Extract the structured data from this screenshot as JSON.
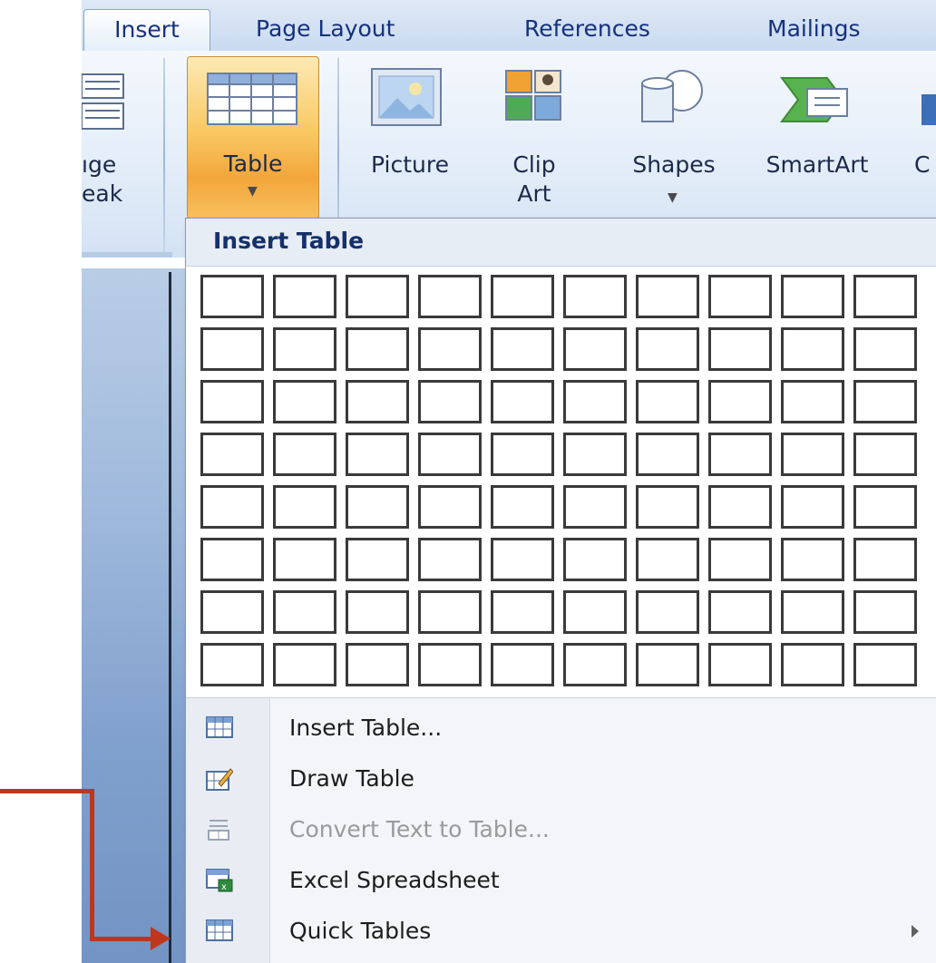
{
  "tabs": [
    {
      "label": "Insert",
      "active": true
    },
    {
      "label": "Page Layout",
      "active": false
    },
    {
      "label": "References",
      "active": false
    },
    {
      "label": "Mailings",
      "active": false
    }
  ],
  "ribbon": {
    "page_break_line1": "ıge",
    "page_break_line2": "eak",
    "table_label": "Table",
    "picture_label": "Picture",
    "clipart_line1": "Clip",
    "clipart_line2": "Art",
    "shapes_label": "Shapes",
    "smartart_label": "SmartArt",
    "chart_label_partial": "C"
  },
  "dropdown": {
    "title": "Insert Table",
    "grid_columns": 10,
    "grid_rows": 8,
    "menu_items": [
      {
        "label": "Insert Table...",
        "icon": "table-icon",
        "disabled": false,
        "submenu": false
      },
      {
        "label": "Draw Table",
        "icon": "pencil-table-icon",
        "disabled": false,
        "submenu": false
      },
      {
        "label": "Convert Text to Table...",
        "icon": "convert-text-icon",
        "disabled": true,
        "submenu": false
      },
      {
        "label": "Excel Spreadsheet",
        "icon": "excel-icon",
        "disabled": false,
        "submenu": false
      },
      {
        "label": "Quick Tables",
        "icon": "table-icon",
        "disabled": false,
        "submenu": true
      }
    ]
  },
  "colors": {
    "accent_orange": "#f3a63b",
    "annotation_red": "#c0361c",
    "tab_text": "#15317d"
  }
}
